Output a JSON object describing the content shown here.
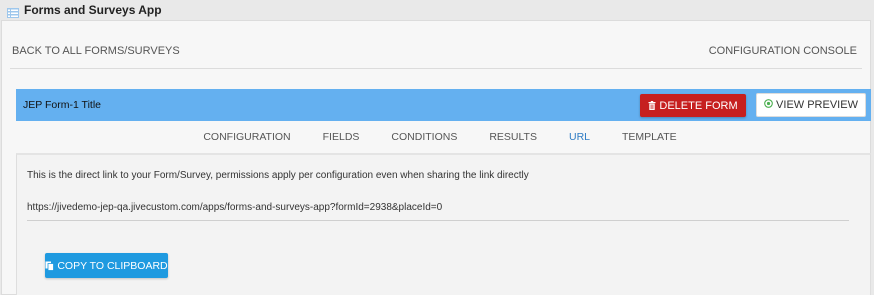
{
  "app": {
    "title": "Forms and Surveys App",
    "icon": "form-list-icon"
  },
  "nav": {
    "back_label": "BACK TO ALL FORMS/SURVEYS",
    "console_label": "CONFIGURATION CONSOLE"
  },
  "form": {
    "title": "JEP Form-1 Title",
    "delete_label": "DELETE FORM",
    "preview_label": "VIEW PREVIEW"
  },
  "tabs": [
    {
      "label": "CONFIGURATION"
    },
    {
      "label": "FIELDS"
    },
    {
      "label": "CONDITIONS"
    },
    {
      "label": "RESULTS"
    },
    {
      "label": "URL",
      "active": true
    },
    {
      "label": "TEMPLATE"
    }
  ],
  "url_panel": {
    "description": "This is the direct link to your Form/Survey, permissions apply per configuration even when sharing the link directly",
    "url": "https://jivedemo-jep-qa.jivecustom.com/apps/forms-and-surveys-app?formId=2938&placeId=0",
    "copy_label": "COPY TO CLIPBOARD"
  },
  "colors": {
    "title_bar": "#64b0f0",
    "delete_button": "#c61f1f",
    "copy_button": "#1f9ae0",
    "active_tab": "#2e7cc4"
  }
}
